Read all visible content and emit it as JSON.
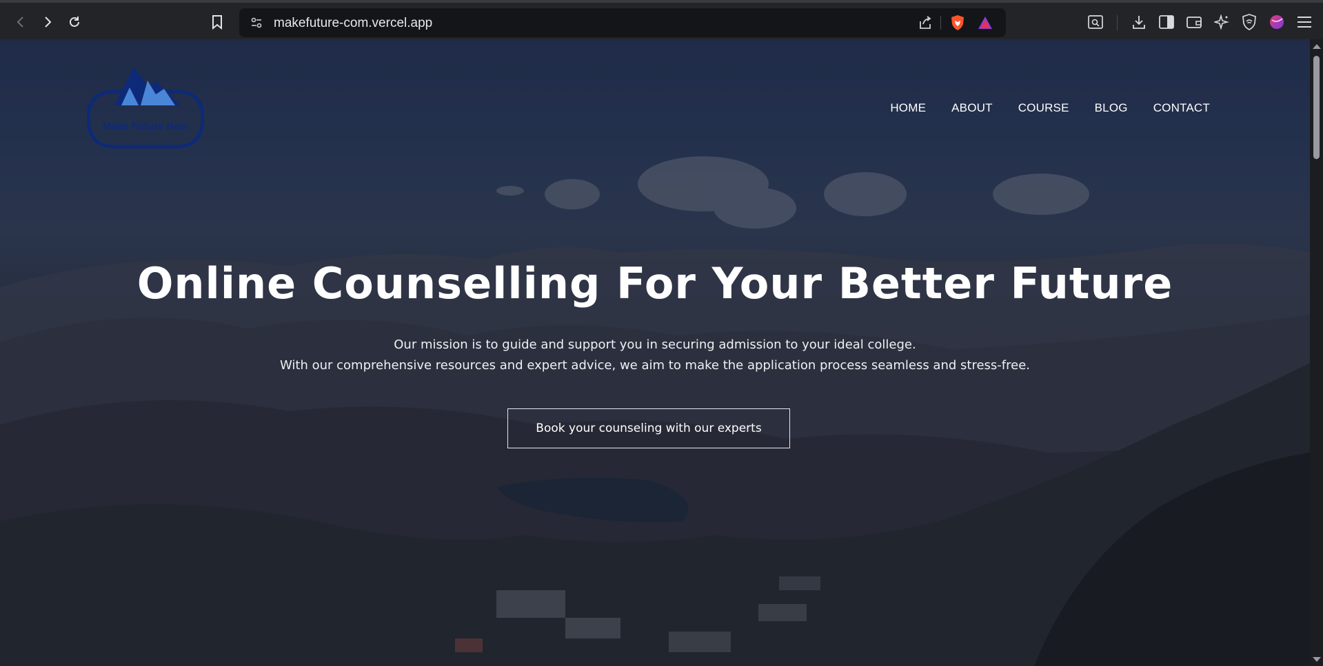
{
  "browser": {
    "url": "makefuture-com.vercel.app",
    "icons": [
      "back-icon",
      "forward-icon",
      "reload-icon",
      "bookmark-icon",
      "site-settings-icon",
      "share-icon",
      "brave-shields-icon",
      "brave-rewards-icon",
      "page-search-icon",
      "download-icon",
      "sidebar-icon",
      "wallet-icon",
      "leo-ai-icon",
      "vpn-icon",
      "profile-icon",
      "menu-icon"
    ]
  },
  "site": {
    "logo_text": "Make Future Now",
    "nav": [
      "HOME",
      "ABOUT",
      "COURSE",
      "BLOG",
      "CONTACT"
    ],
    "headline": "Online Counselling For Your Better Future",
    "subtext_line1": "Our mission is to guide and support you in securing admission to your ideal college.",
    "subtext_line2": "With our comprehensive resources and expert advice, we aim to make the application process seamless and stress-free.",
    "cta_label": "Book your counseling with our experts"
  },
  "colors": {
    "logo_blue": "#0d2a78",
    "mountain_light": "#4a86d8"
  }
}
